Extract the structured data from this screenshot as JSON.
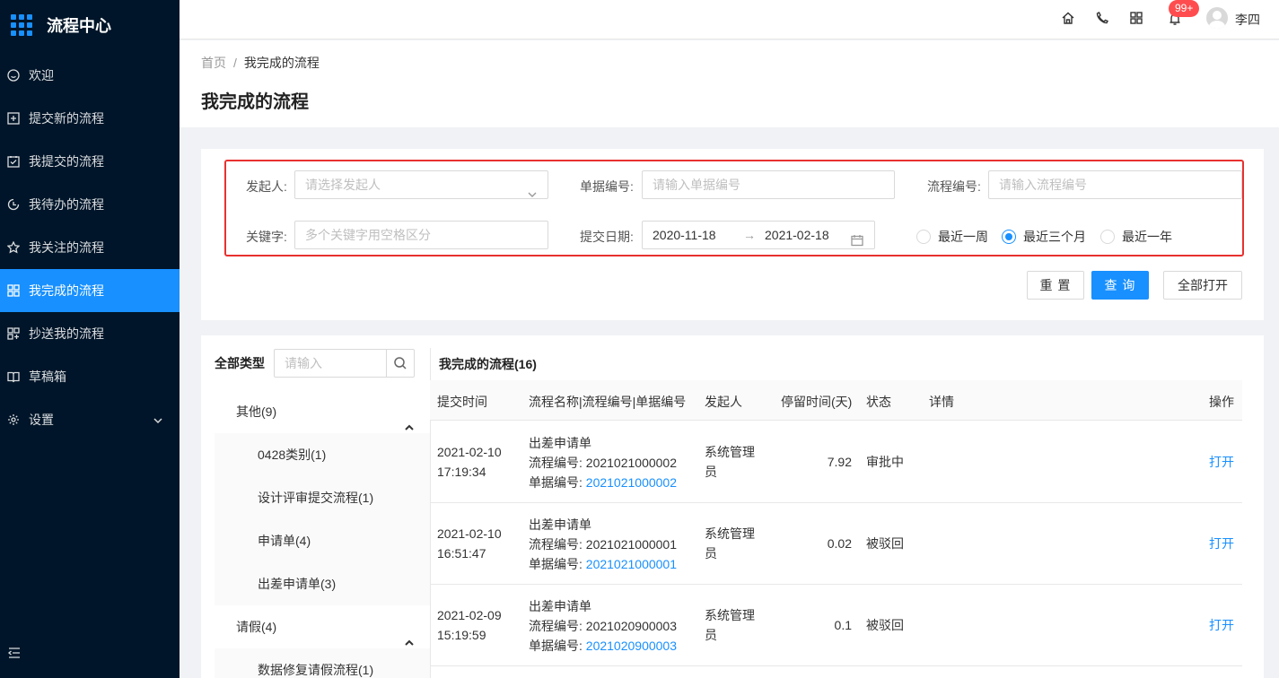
{
  "sidebar": {
    "title": "流程中心",
    "items": [
      {
        "label": "欢迎",
        "icon": "smile-icon"
      },
      {
        "label": "提交新的流程",
        "icon": "plus-square-icon"
      },
      {
        "label": "我提交的流程",
        "icon": "check-square-icon"
      },
      {
        "label": "我待办的流程",
        "icon": "clock-icon"
      },
      {
        "label": "我关注的流程",
        "icon": "star-icon"
      },
      {
        "label": "我完成的流程",
        "icon": "appstore-icon",
        "active": true
      },
      {
        "label": "抄送我的流程",
        "icon": "copy-icon"
      },
      {
        "label": "草稿箱",
        "icon": "book-icon"
      },
      {
        "label": "设置",
        "icon": "gear-icon"
      }
    ]
  },
  "header": {
    "badge": "99+",
    "user": "李四",
    "icons": [
      "home-icon",
      "phone-icon",
      "appstore-icon",
      "bell-icon"
    ]
  },
  "breadcrumb": {
    "home": "首页",
    "sep": "/",
    "current": "我完成的流程"
  },
  "page_title": "我完成的流程",
  "filter": {
    "initiator_label": "发起人:",
    "initiator_placeholder": "请选择发起人",
    "form_no_label": "单据编号:",
    "form_no_placeholder": "请输入单据编号",
    "flow_no_label": "流程编号:",
    "flow_no_placeholder": "请输入流程编号",
    "keyword_label": "关键字:",
    "keyword_placeholder": "多个关键字用空格区分",
    "date_label": "提交日期:",
    "date_start": "2020-11-18",
    "date_arrow": "→",
    "date_end": "2021-02-18",
    "ranges": [
      "最近一周",
      "最近三个月",
      "最近一年"
    ],
    "selected_range": "最近三个月"
  },
  "buttons": {
    "reset": "重 置",
    "query": "查 询",
    "open_all": "全部打开"
  },
  "tree": {
    "header": "全部类型",
    "search_placeholder": "请输入",
    "groups": [
      {
        "label": "其他(9)",
        "children": [
          "0428类别(1)",
          "设计评审提交流程(1)",
          "申请单(4)",
          "出差申请单(3)"
        ]
      },
      {
        "label": "请假(4)",
        "children": [
          "数据修复请假流程(1)"
        ]
      }
    ]
  },
  "table": {
    "title": "我完成的流程(16)",
    "columns": [
      "提交时间",
      "流程名称|流程编号|单据编号",
      "发起人",
      "停留时间(天)",
      "状态",
      "详情",
      "操作"
    ],
    "rows": [
      {
        "date": "2021-02-10",
        "time": "17:19:34",
        "name": "出差申请单",
        "flow_no_label": "流程编号: ",
        "flow_no": "2021021000002",
        "form_no_label": "单据编号: ",
        "form_no": "2021021000002",
        "initiator_1": "系统管理",
        "initiator_2": "员",
        "stay": "7.92",
        "status": "审批中",
        "action": "打开"
      },
      {
        "date": "2021-02-10",
        "time": "16:51:47",
        "name": "出差申请单",
        "flow_no_label": "流程编号: ",
        "flow_no": "2021021000001",
        "form_no_label": "单据编号: ",
        "form_no": "2021021000001",
        "initiator_1": "系统管理",
        "initiator_2": "员",
        "stay": "0.02",
        "status": "被驳回",
        "action": "打开"
      },
      {
        "date": "2021-02-09",
        "time": "15:19:59",
        "name": "出差申请单",
        "flow_no_label": "流程编号: ",
        "flow_no": "2021020900003",
        "form_no_label": "单据编号: ",
        "form_no": "2021020900003",
        "initiator_1": "系统管理",
        "initiator_2": "员",
        "stay": "0.1",
        "status": "被驳回",
        "action": "打开"
      }
    ]
  }
}
